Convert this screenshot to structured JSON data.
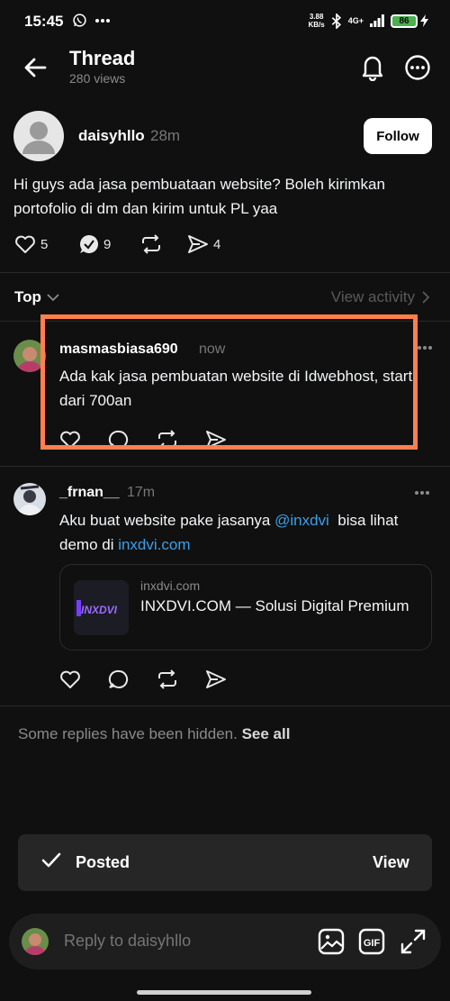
{
  "status_bar": {
    "time": "15:45",
    "net_speed_value": "3.88",
    "net_speed_unit": "KB/s",
    "network": "4G+",
    "battery": "86"
  },
  "header": {
    "title": "Thread",
    "views": "280 views",
    "icons": [
      "back-arrow-icon",
      "bell-icon",
      "more-icon"
    ]
  },
  "post": {
    "author": "daisyhllo",
    "time": "28m",
    "follow_label": "Follow",
    "text": "Hi guys ada jasa pembuataan website? Boleh kirimkan portofolio di dm dan kirim untuk PL yaa",
    "likes": "5",
    "replies": "9",
    "shares": "4"
  },
  "sort": {
    "label": "Top",
    "view_activity": "View activity"
  },
  "replies": [
    {
      "author": "masmasbiasa690",
      "time": "now",
      "text": "Ada kak jasa pembuatan website di Idwebhost, start dari 700an"
    },
    {
      "author": "_frnan__",
      "time": "17m",
      "text_before": "Aku buat website pake jasanya ",
      "mention": "@inxdvi",
      "text_middle": "  bisa lihat demo di ",
      "link": "inxdvi.com",
      "card": {
        "domain": "inxdvi.com",
        "title": "INXDVI.COM — Solusi Digital Premium",
        "logo_text": "INXDVI"
      }
    }
  ],
  "hidden_note": {
    "text": "Some replies have been hidden.",
    "see_all": "See all"
  },
  "toast": {
    "label": "Posted",
    "action": "View"
  },
  "reply_bar": {
    "placeholder": "Reply to daisyhllo"
  },
  "colors": {
    "background": "#101010",
    "highlight": "#ff7f4d",
    "link": "#3b9fe8",
    "battery": "#4caf50"
  }
}
